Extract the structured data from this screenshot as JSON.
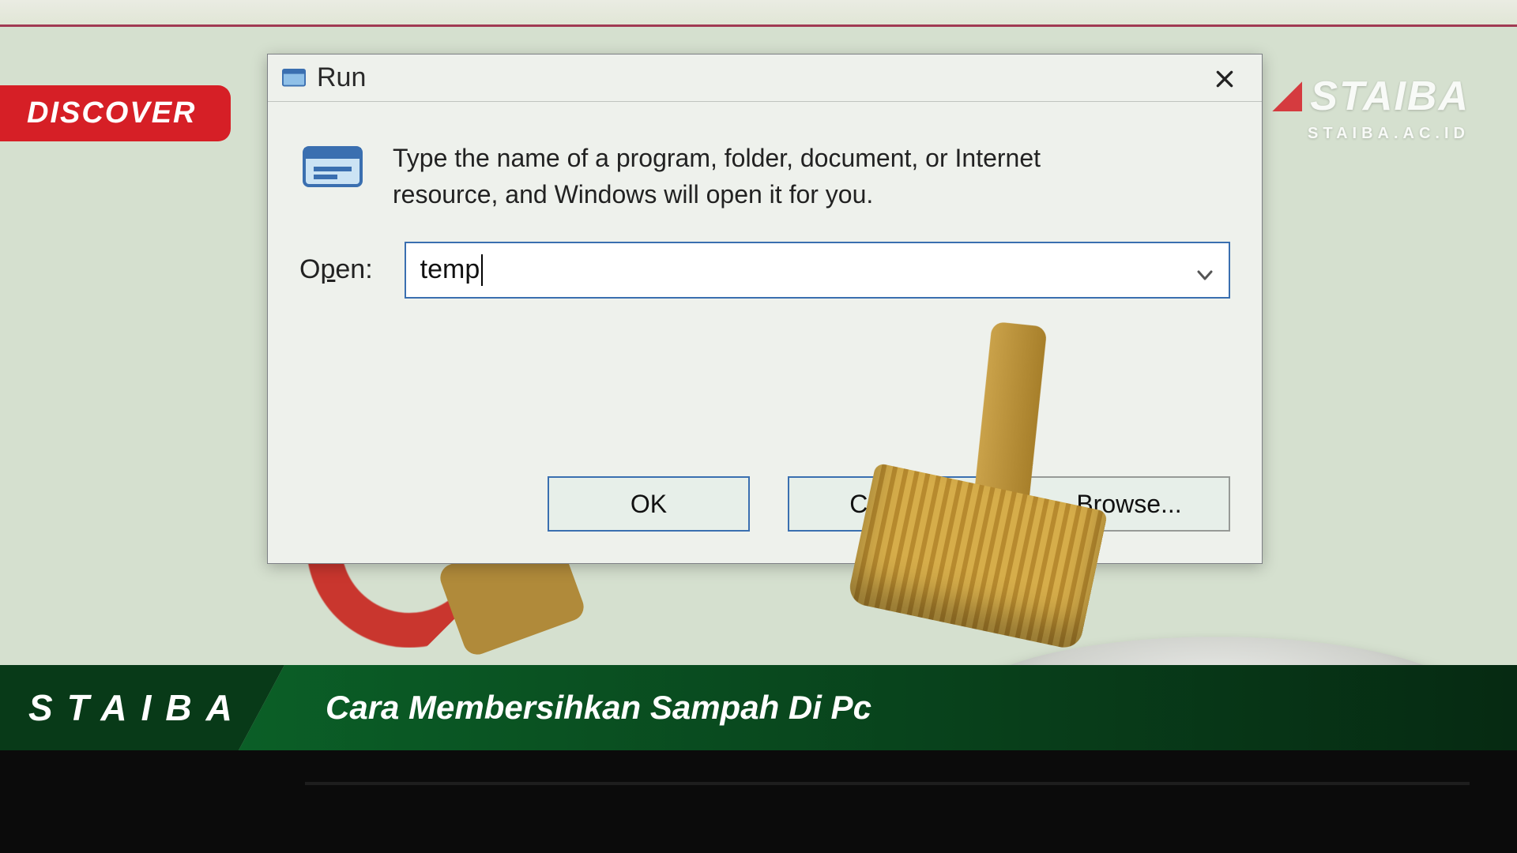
{
  "badge": {
    "label": "DISCOVER"
  },
  "watermark": {
    "title": "STAIBA",
    "subtitle": "STAIBA.AC.ID"
  },
  "dialog": {
    "title": "Run",
    "description": "Type the name of a program, folder, document, or Internet resource, and Windows will open it for you.",
    "open_label_pre": "O",
    "open_label_u": "p",
    "open_label_post": "en:",
    "input_value": "temp",
    "buttons": {
      "ok": "OK",
      "cancel": "Cancel",
      "browse_u": "B",
      "browse_post": "rowse..."
    }
  },
  "banner": {
    "brand": "STAIBA",
    "headline": "Cara Membersihkan Sampah Di Pc"
  }
}
